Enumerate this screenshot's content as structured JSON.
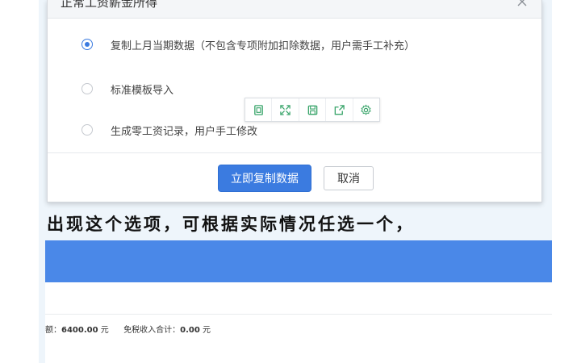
{
  "dialog": {
    "title": "正常工资薪金所得",
    "options": [
      {
        "label": "复制上月当期数据（不包含专项附加扣除数据，用户需手工补充）",
        "checked": true
      },
      {
        "label": "标准模板导入",
        "checked": false
      },
      {
        "label": "生成零工资记录，用户手工修改",
        "checked": false
      }
    ],
    "toolbar_icons": [
      "copy-icon",
      "fullscreen-icon",
      "save-icon",
      "share-icon",
      "settings-icon"
    ],
    "confirm_label": "立即复制数据",
    "cancel_label": "取消"
  },
  "caption": "出现这个选项，可根据实际情况任选一个，",
  "summary": {
    "amount_label_tail": "额：",
    "amount_value": "6400.00",
    "amount_unit": "元",
    "tax_free_label": "免税收入合计：",
    "tax_free_value": "0.00",
    "tax_free_unit": "元"
  },
  "colors": {
    "accent": "#3b7be0",
    "banner": "#4a88e8",
    "toolbar_icon": "#3aa56b"
  }
}
